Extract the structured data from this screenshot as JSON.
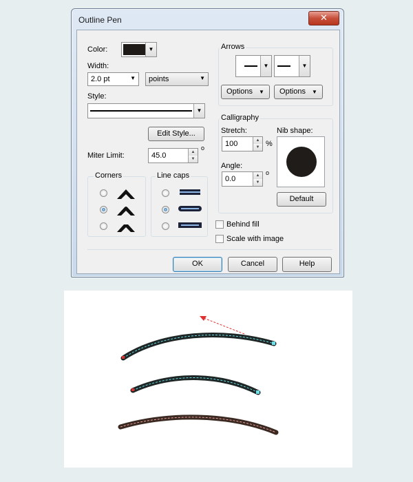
{
  "dialog": {
    "title": "Outline Pen",
    "close_glyph": "✕",
    "color_label": "Color:",
    "color_value": "#1f1b18",
    "width_label": "Width:",
    "width_value": "2.0 pt",
    "width_units": "points",
    "style_label": "Style:",
    "edit_style_label": "Edit Style...",
    "miter_limit_label": "Miter Limit:",
    "miter_limit_value": "45.0",
    "degree_symbol": "o",
    "corners_label": "Corners",
    "corners_selected": 1,
    "line_caps_label": "Line caps",
    "line_caps_selected": 1,
    "arrows_label": "Arrows",
    "options_left_label": "Options",
    "options_right_label": "Options",
    "calligraphy_label": "Calligraphy",
    "stretch_label": "Stretch:",
    "stretch_value": "100",
    "percent_symbol": "%",
    "angle_label": "Angle:",
    "angle_value": "0.0",
    "nib_shape_label": "Nib shape:",
    "default_label": "Default",
    "behind_fill_label": "Behind fill",
    "scale_with_image_label": "Scale with image",
    "ok_label": "OK",
    "cancel_label": "Cancel",
    "help_label": "Help"
  },
  "colors": {
    "stroke_dark": "#1e2626",
    "stroke_brown": "#3a2a22",
    "centerline_cyan": "#6fe0e8",
    "centerline_pink": "#f0a0a0",
    "arrow_red": "#e23030"
  }
}
